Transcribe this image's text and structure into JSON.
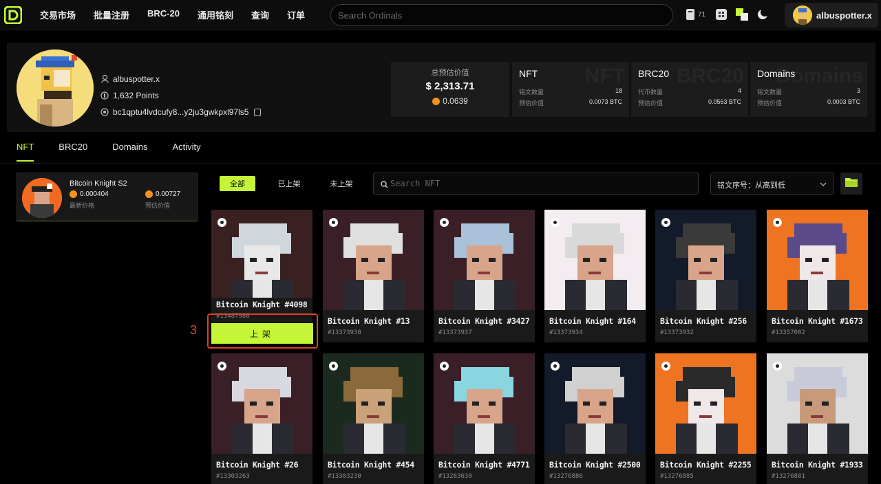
{
  "nav": {
    "items": [
      "交易市场",
      "批量注册",
      "BRC-20",
      "通用铭刻",
      "查询",
      "订单"
    ],
    "search_placeholder": "Search Ordinals",
    "notification_count": "71",
    "username": "albuspotter.x"
  },
  "profile": {
    "username": "albuspotter.x",
    "points": "1,632 Points",
    "address": "bc1qptu4lvdcufy8...y2ju3gwkpxl97ls5"
  },
  "stats": {
    "total": {
      "label": "总预估价值",
      "usd": "$ 2,313.71",
      "btc": "0.0639"
    },
    "cards": [
      {
        "title": "NFT",
        "ghost": "NFT",
        "row1_label": "铭文数量",
        "row1_value": "18",
        "row2_label": "预估价值",
        "row2_value": "0.0073 BTC"
      },
      {
        "title": "BRC20",
        "ghost": "BRC20",
        "row1_label": "代币数量",
        "row1_value": "4",
        "row2_label": "预估价值",
        "row2_value": "0.0563 BTC"
      },
      {
        "title": "Domains",
        "ghost": "Domains",
        "row1_label": "铭文数量",
        "row1_value": "3",
        "row2_label": "预估价值",
        "row2_value": "0.0003 BTC"
      }
    ]
  },
  "tabs": [
    "NFT",
    "BRC20",
    "Domains",
    "Activity"
  ],
  "collection": {
    "name": "Bitcoin Knight S2",
    "latest_price": "0.000404",
    "latest_price_label": "最新价格",
    "est_value": "0.00727",
    "est_value_label": "预估价值"
  },
  "filters": {
    "all": "全部",
    "listed": "已上架",
    "unlisted": "未上架",
    "search_placeholder": "Search NFT",
    "sort": "铭文序号：从高到低"
  },
  "nfts": [
    {
      "name": "Bitcoin Knight #4098",
      "number": "#13487988",
      "bg": "#3a2020"
    },
    {
      "name": "Bitcoin Knight #13",
      "number": "#13373938",
      "bg": "#3a1f26"
    },
    {
      "name": "Bitcoin Knight #3427",
      "number": "#13373937",
      "bg": "#3a1f26"
    },
    {
      "name": "Bitcoin Knight #164",
      "number": "#13373934",
      "bg": "#f3ecf0"
    },
    {
      "name": "Bitcoin Knight #256",
      "number": "#13373932",
      "bg": "#131a2a"
    },
    {
      "name": "Bitcoin Knight #1673",
      "number": "#13357002",
      "bg": "#ee7422"
    },
    {
      "name": "Bitcoin Knight #26",
      "number": "#13303263",
      "bg": "#3a1f26"
    },
    {
      "name": "Bitcoin Knight #454",
      "number": "#13303230",
      "bg": "#1b2a1e"
    },
    {
      "name": "Bitcoin Knight #4771",
      "number": "#13283630",
      "bg": "#3a1f26"
    },
    {
      "name": "Bitcoin Knight #2500",
      "number": "#13276886",
      "bg": "#131a2a"
    },
    {
      "name": "Bitcoin Knight #2255",
      "number": "#13276885",
      "bg": "#ee7422"
    },
    {
      "name": "Bitcoin Knight #1933",
      "number": "#13276881",
      "bg": "#dcdcdc"
    }
  ],
  "list_button": "上架",
  "annotation": "3",
  "colors": {
    "accent": "#c4f536",
    "highlight": "#e2402b",
    "btc": "#f7931a"
  }
}
